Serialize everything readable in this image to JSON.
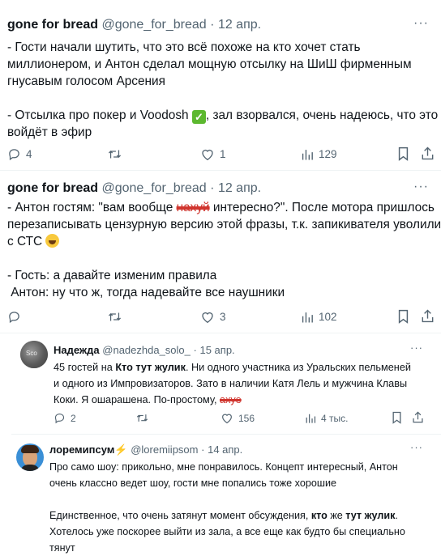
{
  "tweet1": {
    "name": "gone for bread",
    "handle": "@gone_for_bread",
    "dot": "·",
    "date": "12 апр.",
    "lines": [
      "- Гости начали шутить, что это всё похоже на кто хочет стать",
      "миллионером, и Антон сделал мощную отсылку на ШиШ фирменным",
      "гнусавым голосом Арсения",
      "",
      "- Отсылка про покер и Voodosh",
      ", зал взорвался, очень надеюсь, что это",
      "войдёт в эфир"
    ],
    "replies": "4",
    "retweets": "",
    "likes": "1",
    "views": "129"
  },
  "tweet2": {
    "name": "gone for bread",
    "handle": "@gone_for_bread",
    "dot": "·",
    "date": "12 апр.",
    "line1_a": "- Антон гостям: \"вам вообще ",
    "line1_redacted": "нахуй",
    "line1_b": " интересно?\". После мотора пришлось",
    "line2": "перезаписывать цензурную версию этой фразы, т.к. запикивателя уволили",
    "line3": "с СТС ",
    "line4": "- Гость: а давайте изменим правила",
    "line5": " Антон: ну что ж, тогда надевайте все наушники",
    "replies": "",
    "retweets": "",
    "likes": "3",
    "views": "102"
  },
  "reply1": {
    "name": "Надежда",
    "handle": "@nadezhda_solo_",
    "dot": "·",
    "date": "15 апр.",
    "avatar_text": "Sco",
    "line1_a": "45 гостей на ",
    "line1_bold": "Кто тут жулик",
    "line1_b": ". Ни одного участника из Уральских пельменей",
    "line2": "и одного из Импровизаторов. Зато в наличии Катя Лель и мужчина Клавы",
    "line3": "Коки. Я ошарашена. По-простому, ",
    "line3_redacted": "ахуе",
    "replies": "2",
    "retweets": "",
    "likes": "156",
    "views": "4 тыс."
  },
  "reply2": {
    "name": "лоремипсум",
    "handle": "@loremiipsom",
    "dot": "·",
    "date": "14 апр.",
    "line1": "Про само шоу: прикольно, мне понравилось. Концепт интересный, Антон",
    "line2": "очень классно ведет шоу, гости мне попались тоже хорошие",
    "line3_a": "Единственное, что очень затянут момент обсуждения, ",
    "line3_b1": "кто",
    "line3_c": " же ",
    "line3_b2": "тут жулик",
    "line3_d": ".",
    "line4": "Хотелось уже поскорее выйти из зала, а все еще как будто бы специально",
    "line5": "тянут"
  },
  "colors": {
    "text": "#0f1419",
    "muted": "#536471",
    "redaction": "#d0352e",
    "divider": "#eff3f4"
  },
  "icons": [
    "reply-icon",
    "retweet-icon",
    "like-icon",
    "views-icon",
    "bookmark-icon",
    "share-icon",
    "more-icon",
    "lightning-icon"
  ]
}
